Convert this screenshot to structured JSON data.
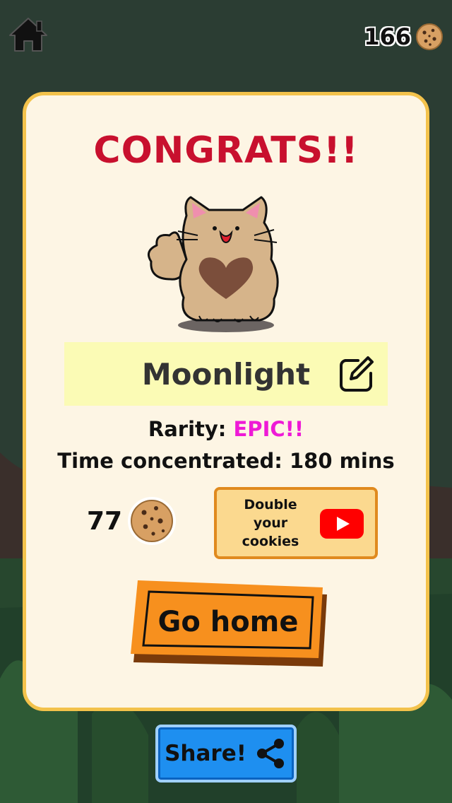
{
  "topbar": {
    "cookie_count": "166"
  },
  "card": {
    "title": "CONGRATS!!",
    "pet_name": "Moonlight",
    "rarity_label": "Rarity: ",
    "rarity_value": "EPIC!!",
    "time_text": "Time concentrated: 180 mins",
    "reward_amount": "77",
    "double_line1": "Double your",
    "double_line2": "cookies",
    "go_home_label": "Go home"
  },
  "share": {
    "label": "Share!"
  },
  "icons": {
    "home": "home-icon",
    "cookie": "cookie-icon",
    "edit": "edit-icon",
    "video": "youtube-play-icon",
    "share": "share-icon"
  },
  "colors": {
    "title": "#c8102e",
    "rarity_epic": "#ee1ad6",
    "card_bg": "#fdf5e4",
    "card_border": "#f3c24b",
    "go_home_button": "#f7901e",
    "share_button": "#1e8ff0",
    "name_box": "#fbfbb5"
  }
}
